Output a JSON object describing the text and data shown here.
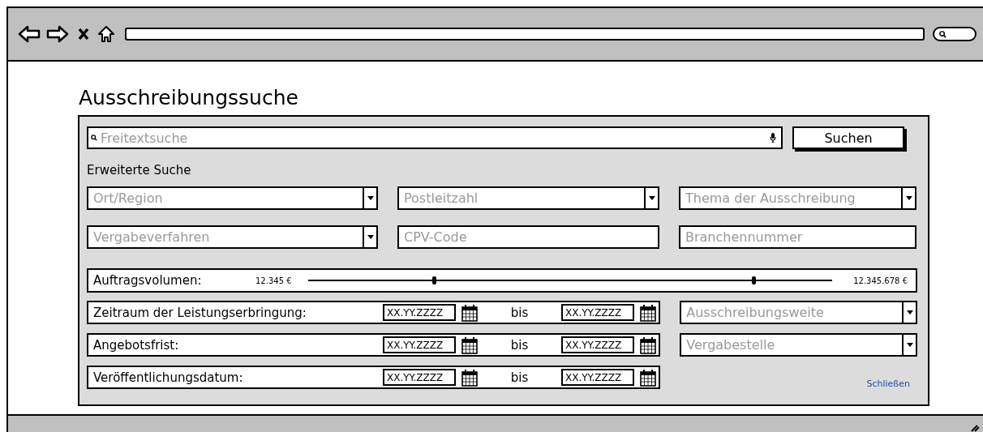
{
  "title": "Ausschreibungssuche",
  "search": {
    "placeholder": "Freitextsuche",
    "button": "Suchen"
  },
  "advanced_label": "Erweiterte Suche",
  "filters": [
    {
      "kind": "dropdown",
      "placeholder": "Ort/Region"
    },
    {
      "kind": "dropdown",
      "placeholder": "Postleitzahl"
    },
    {
      "kind": "dropdown",
      "placeholder": "Thema der Ausschreibung"
    },
    {
      "kind": "dropdown",
      "placeholder": "Vergabeverfahren"
    },
    {
      "kind": "text",
      "placeholder": "CPV-Code"
    },
    {
      "kind": "text",
      "placeholder": "Branchennummer"
    }
  ],
  "volume": {
    "label": "Auftragsvolumen:",
    "min": "12.345 €",
    "max": "12.345.678 €",
    "thumbs": [
      {
        "level": 0.24
      },
      {
        "level": 0.85
      }
    ]
  },
  "date_rows": [
    {
      "label": "Zeitraum der Leistungserbringung:",
      "from": "XX.YY.ZZZZ",
      "separator": "bis",
      "to": "XX.YY.ZZZZ",
      "side": {
        "kind": "dropdown",
        "placeholder": "Ausschreibungsweite"
      }
    },
    {
      "label": "Angebotsfrist:",
      "from": "XX.YY.ZZZZ",
      "separator": "bis",
      "to": "XX.YY.ZZZZ",
      "side": {
        "kind": "dropdown",
        "placeholder": "Vergabestelle"
      }
    },
    {
      "label": "Veröffentlichungsdatum:",
      "from": "XX.YY.ZZZZ",
      "separator": "bis",
      "to": "XX.YY.ZZZZ",
      "side": {
        "kind": "link",
        "text": "Schließen"
      }
    }
  ]
}
